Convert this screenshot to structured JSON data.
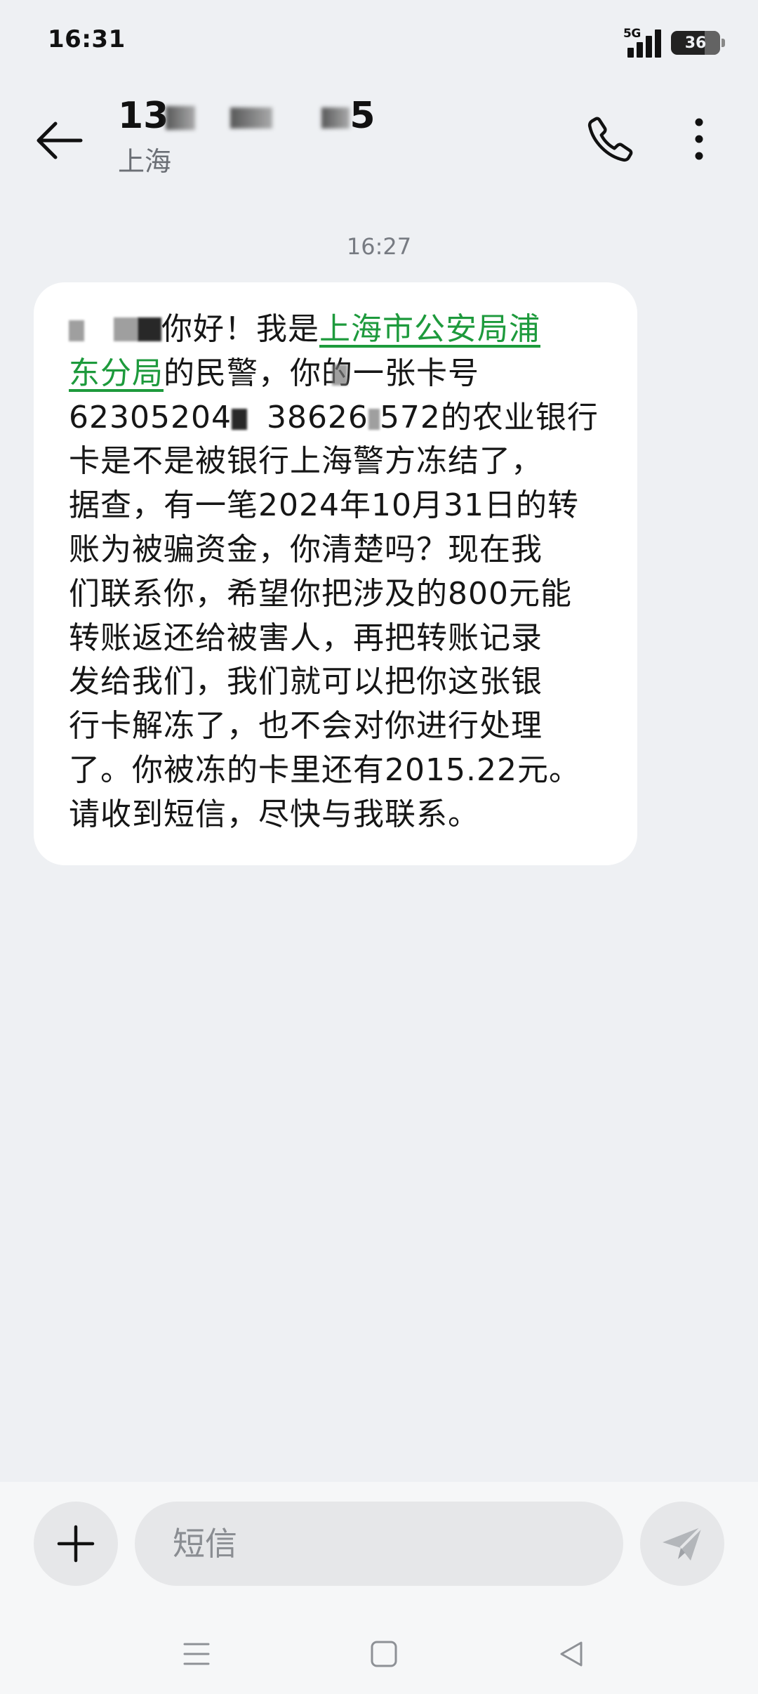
{
  "status_bar": {
    "time": "16:31",
    "network": "5G",
    "signal_bars": 4,
    "battery_level": "36"
  },
  "header": {
    "contact_prefix": "13",
    "contact_suffix": "5",
    "location": "上海",
    "icons": [
      "arrow-left-icon",
      "phone-icon",
      "more-vertical-icon"
    ]
  },
  "conversation": {
    "timestamp": "16:27",
    "message": {
      "greeting": "你好！我是",
      "link_part1": "上海市公安局浦",
      "link_part2": "东分局",
      "l2_a": "的民警，你的",
      "l2_b": "一张卡号",
      "card_a": "62305204",
      "card_b": "38626",
      "card_c": "572的农业银行",
      "l4": "卡是不是被银行上海警方冻结了，",
      "l5": "据查，有一笔2024年10月31日的转",
      "l6": "账为被骗资金，你清楚吗？现在我",
      "l7": "们联系你，希望你把涉及的800元能",
      "l8": "转账返还给被害人，再把转账记录",
      "l9": "发给我们，我们就可以把你这张银",
      "l10": "行卡解冻了，也不会对你进行处理",
      "l11": "了。你被冻的卡里还有2015.22元。",
      "l12": "请收到短信，尽快与我联系。"
    }
  },
  "composer": {
    "placeholder": "短信",
    "icons": [
      "plus-icon",
      "send-icon"
    ]
  },
  "nav_bar": {
    "icons": [
      "menu-icon",
      "home-square-icon",
      "back-triangle-icon"
    ]
  },
  "colors": {
    "background": "#eef0f3",
    "bubble": "#ffffff",
    "link": "#1d9a3c",
    "muted_text": "#777b82"
  }
}
